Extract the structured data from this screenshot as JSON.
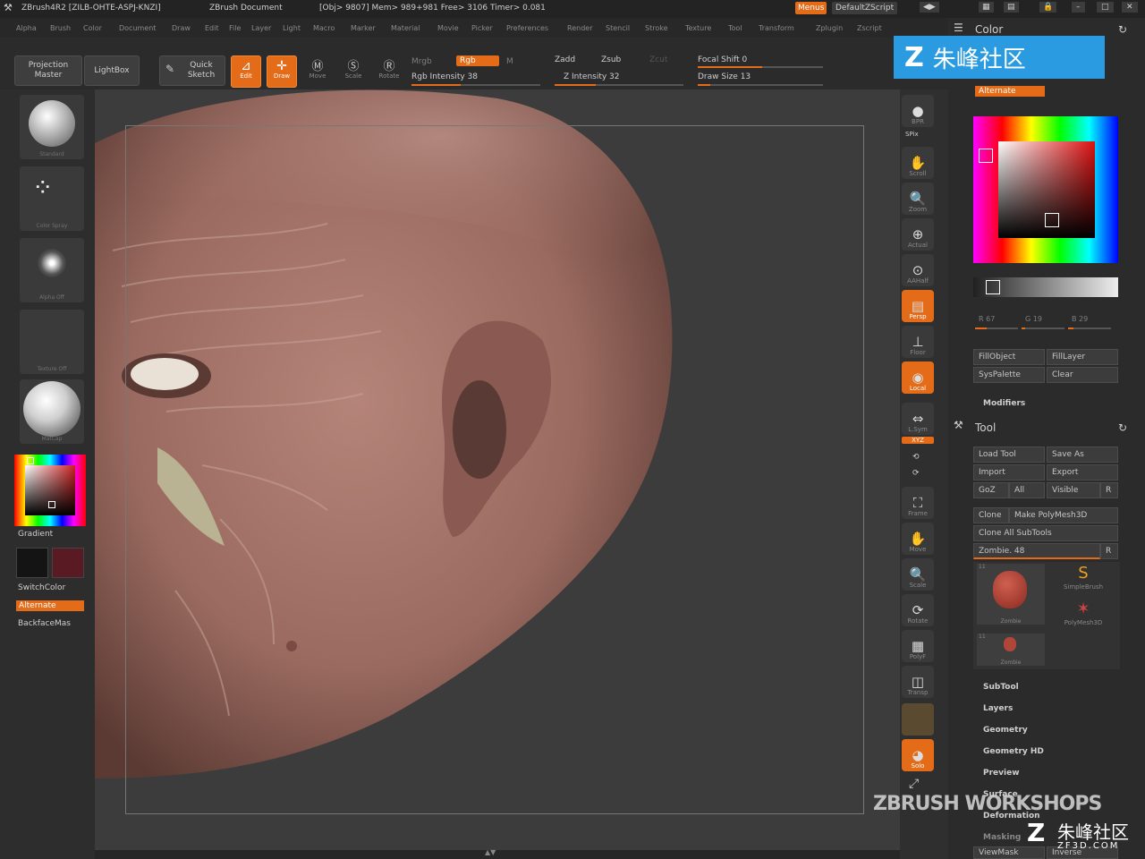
{
  "titlebar": {
    "app": "ZBrush4R2 [ZILB-OHTE-ASPJ-KNZI]",
    "doc": "ZBrush Document",
    "stats": "[Obj> 9807] Mem> 989+981 Free> 3106 Timer> 0.081",
    "menus": "Menus",
    "script": "DefaultZScript"
  },
  "menubar": [
    "Alpha",
    "Brush",
    "Color",
    "Document",
    "Draw",
    "Edit",
    "File",
    "Layer",
    "Light",
    "Macro",
    "Marker",
    "Material",
    "Movie",
    "Picker",
    "Preferences",
    "Render",
    "Stencil",
    "Stroke",
    "Texture",
    "Tool",
    "Transform",
    "Zplugin",
    "Zscript"
  ],
  "toolbar": {
    "projection_master": "Projection Master",
    "lightbox": "LightBox",
    "quick_sketch": "Quick Sketch",
    "edit": "Edit",
    "draw": "Draw",
    "move": "Move",
    "scale": "Scale",
    "rotate": "Rotate",
    "mrgb": "Mrgb",
    "rgb": "Rgb",
    "m": "M",
    "rgb_intensity": "Rgb Intensity 38",
    "zadd": "Zadd",
    "zsub": "Zsub",
    "zcut": "Zcut",
    "z_intensity": "Z Intensity 32",
    "focal_shift": "Focal Shift 0",
    "draw_size": "Draw Size 13",
    "rgb_intensity_value": 38,
    "z_intensity_value": 32,
    "draw_size_value": 13
  },
  "left": {
    "thumbs": [
      "Standard",
      "Color Spray",
      "Alpha Off",
      "Texture Off",
      "MatCap"
    ],
    "gradient": "Gradient",
    "switch_color": "SwitchColor",
    "alternate": "Alternate",
    "backface": "BackfaceMas",
    "main_color": "#141414",
    "secondary_color": "#5a1a24"
  },
  "right_tools": [
    {
      "label": "BPR",
      "active": false
    },
    {
      "label": "SPix",
      "active": false
    },
    {
      "label": "Scroll",
      "active": false
    },
    {
      "label": "Zoom",
      "active": false
    },
    {
      "label": "Actual",
      "active": false
    },
    {
      "label": "AAHalf",
      "active": false
    },
    {
      "label": "Persp",
      "active": true
    },
    {
      "label": "Floor",
      "active": false
    },
    {
      "label": "Local",
      "active": true
    },
    {
      "label": "L.Sym",
      "active": false
    },
    {
      "label": "XYZ",
      "active": true
    },
    {
      "label": "Frame",
      "active": false
    },
    {
      "label": "Move",
      "active": false
    },
    {
      "label": "Scale",
      "active": false
    },
    {
      "label": "Rotate",
      "active": false
    },
    {
      "label": "PolyF",
      "active": false
    },
    {
      "label": "Transp",
      "active": false
    },
    {
      "label": "Solo",
      "active": true
    }
  ],
  "color_panel": {
    "title": "Color",
    "alternate": "Alternate",
    "r": "R 67",
    "g": "G 19",
    "b": "B 29",
    "fill_object": "FillObject",
    "fill_layer": "FillLayer",
    "syspalette": "SysPalette",
    "clear": "Clear",
    "modifiers": "Modifiers"
  },
  "tool_panel": {
    "title": "Tool",
    "load": "Load Tool",
    "save": "Save As",
    "import": "Import",
    "export": "Export",
    "goz": "GoZ",
    "all": "All",
    "visible": "Visible",
    "r": "R",
    "clone": "Clone",
    "make_polymesh": "Make PolyMesh3D",
    "clone_all": "Clone All SubTools",
    "zombie": "Zombie. 48",
    "tools": [
      "Zombie",
      "SimpleBrush",
      "PolyMesh3D",
      "Zombie"
    ],
    "counts": [
      "11",
      "11"
    ],
    "sections": [
      "SubTool",
      "Layers",
      "Geometry",
      "Geometry HD",
      "Preview",
      "Surface",
      "Deformation",
      "Masking"
    ],
    "viewmask": "ViewMask",
    "inverse": "Inverse"
  },
  "watermark": {
    "top": "朱峰社区",
    "footer": "ZBRUSH WORKSHOPS",
    "corner": "朱峰社区",
    "corner_sub": "ZF3D.COM"
  }
}
